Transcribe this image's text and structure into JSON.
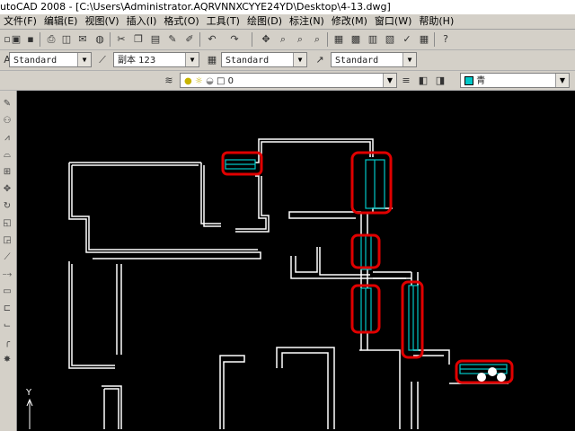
{
  "title": "utoCAD 2008 - [C:\\Users\\Administrator.AQRVNNXCYYE24YD\\Desktop\\4-13.dwg]",
  "menu": [
    "文件(F)",
    "编辑(E)",
    "视图(V)",
    "插入(I)",
    "格式(O)",
    "工具(T)",
    "绘图(D)",
    "标注(N)",
    "修改(M)",
    "窗口(W)",
    "帮助(H)"
  ],
  "styles_toolbar": {
    "text_style": "Standard",
    "dim_style": "副本 123",
    "table_style": "Standard",
    "multileader_style": "Standard"
  },
  "layers_toolbar": {
    "current_layer": "0",
    "color_control": "青"
  },
  "icons": {
    "toolbar1": [
      "new-icon",
      "open-icon",
      "save-icon",
      "print-icon",
      "preview-icon",
      "publish-icon",
      "3d-dwf-icon",
      "cut-icon",
      "copy-icon",
      "paste-icon",
      "match-properties-icon",
      "undo-icon",
      "redo-icon",
      "pan-icon",
      "zoom-realtime-icon",
      "zoom-window-icon",
      "zoom-previous-icon",
      "properties-icon",
      "design-center-icon",
      "tool-palettes-icon",
      "sheet-set-icon",
      "markup-icon",
      "calculator-icon",
      "help-icon"
    ],
    "draw_toolbar": [
      "line-icon",
      "construction-line-icon",
      "polyline-icon",
      "polygon-icon",
      "rectangle-icon",
      "arc-icon",
      "circle-icon",
      "revision-cloud-icon",
      "spline-icon",
      "ellipse-icon",
      "ellipse-arc-icon",
      "insert-block-icon",
      "make-block-icon",
      "point-icon",
      "hatch-icon",
      "gradient-icon",
      "region-icon",
      "table-icon",
      "mtext-icon",
      "erase-icon",
      "copy-object-icon",
      "mirror-icon",
      "offset-icon",
      "array-icon",
      "move-icon",
      "rotate-icon",
      "scale-icon",
      "stretch-icon",
      "trim-icon",
      "extend-icon",
      "break-icon",
      "chamfer-icon",
      "fillet-icon",
      "explode-icon"
    ]
  },
  "colors": {
    "canvas_bg": "#000000",
    "wall": "#ffffff",
    "window": "#00c8c8",
    "highlight": "#e00000"
  },
  "ucs_label": "Y"
}
